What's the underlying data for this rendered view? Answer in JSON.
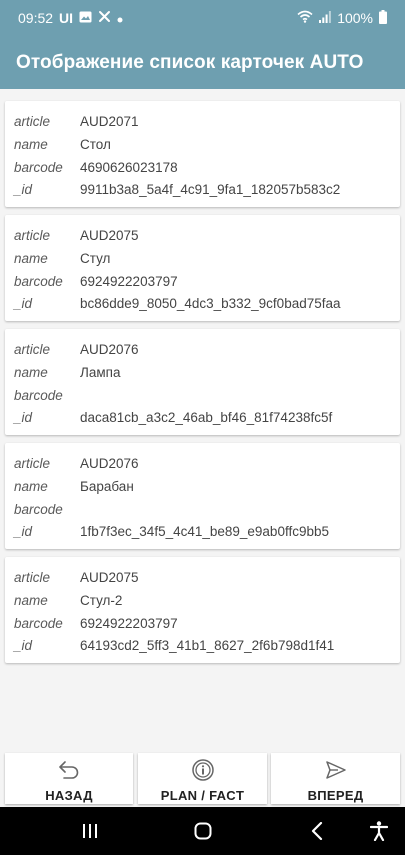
{
  "status_bar": {
    "time": "09:52",
    "ui_label": "UI",
    "battery": "100%"
  },
  "app_bar": {
    "title": "Отображение список карточек AUTO"
  },
  "field_keys": {
    "article": "article",
    "name": "name",
    "barcode": "barcode",
    "id": "_id"
  },
  "cards": [
    {
      "article": "AUD2071",
      "name": "Стол",
      "barcode": "4690626023178",
      "id": "9911b3a8_5a4f_4c91_9fa1_182057b583c2"
    },
    {
      "article": "AUD2075",
      "name": "Стул",
      "barcode": "6924922203797",
      "id": "bc86dde9_8050_4dc3_b332_9cf0bad75faa"
    },
    {
      "article": "AUD2076",
      "name": "Лампа",
      "barcode": "",
      "id": "daca81cb_a3c2_46ab_bf46_81f74238fc5f"
    },
    {
      "article": "AUD2076",
      "name": "Барабан",
      "barcode": "",
      "id": "1fb7f3ec_34f5_4c41_be89_e9ab0ffc9bb5"
    },
    {
      "article": "AUD2075",
      "name": "Стул-2",
      "barcode": "6924922203797",
      "id": "64193cd2_5ff3_41b1_8627_2f6b798d1f41"
    }
  ],
  "bottom_nav": {
    "back_label": "НАЗАД",
    "back_icon": "undo-arrow-icon",
    "plan_fact_label": "PLAN / FACT",
    "plan_fact_icon": "info-circle-icon",
    "forward_label": "ВПЕРЕД",
    "forward_icon": "send-icon"
  },
  "colors": {
    "app_bar": "#6e9fb0",
    "background": "#f4f4f4",
    "card": "#ffffff"
  }
}
